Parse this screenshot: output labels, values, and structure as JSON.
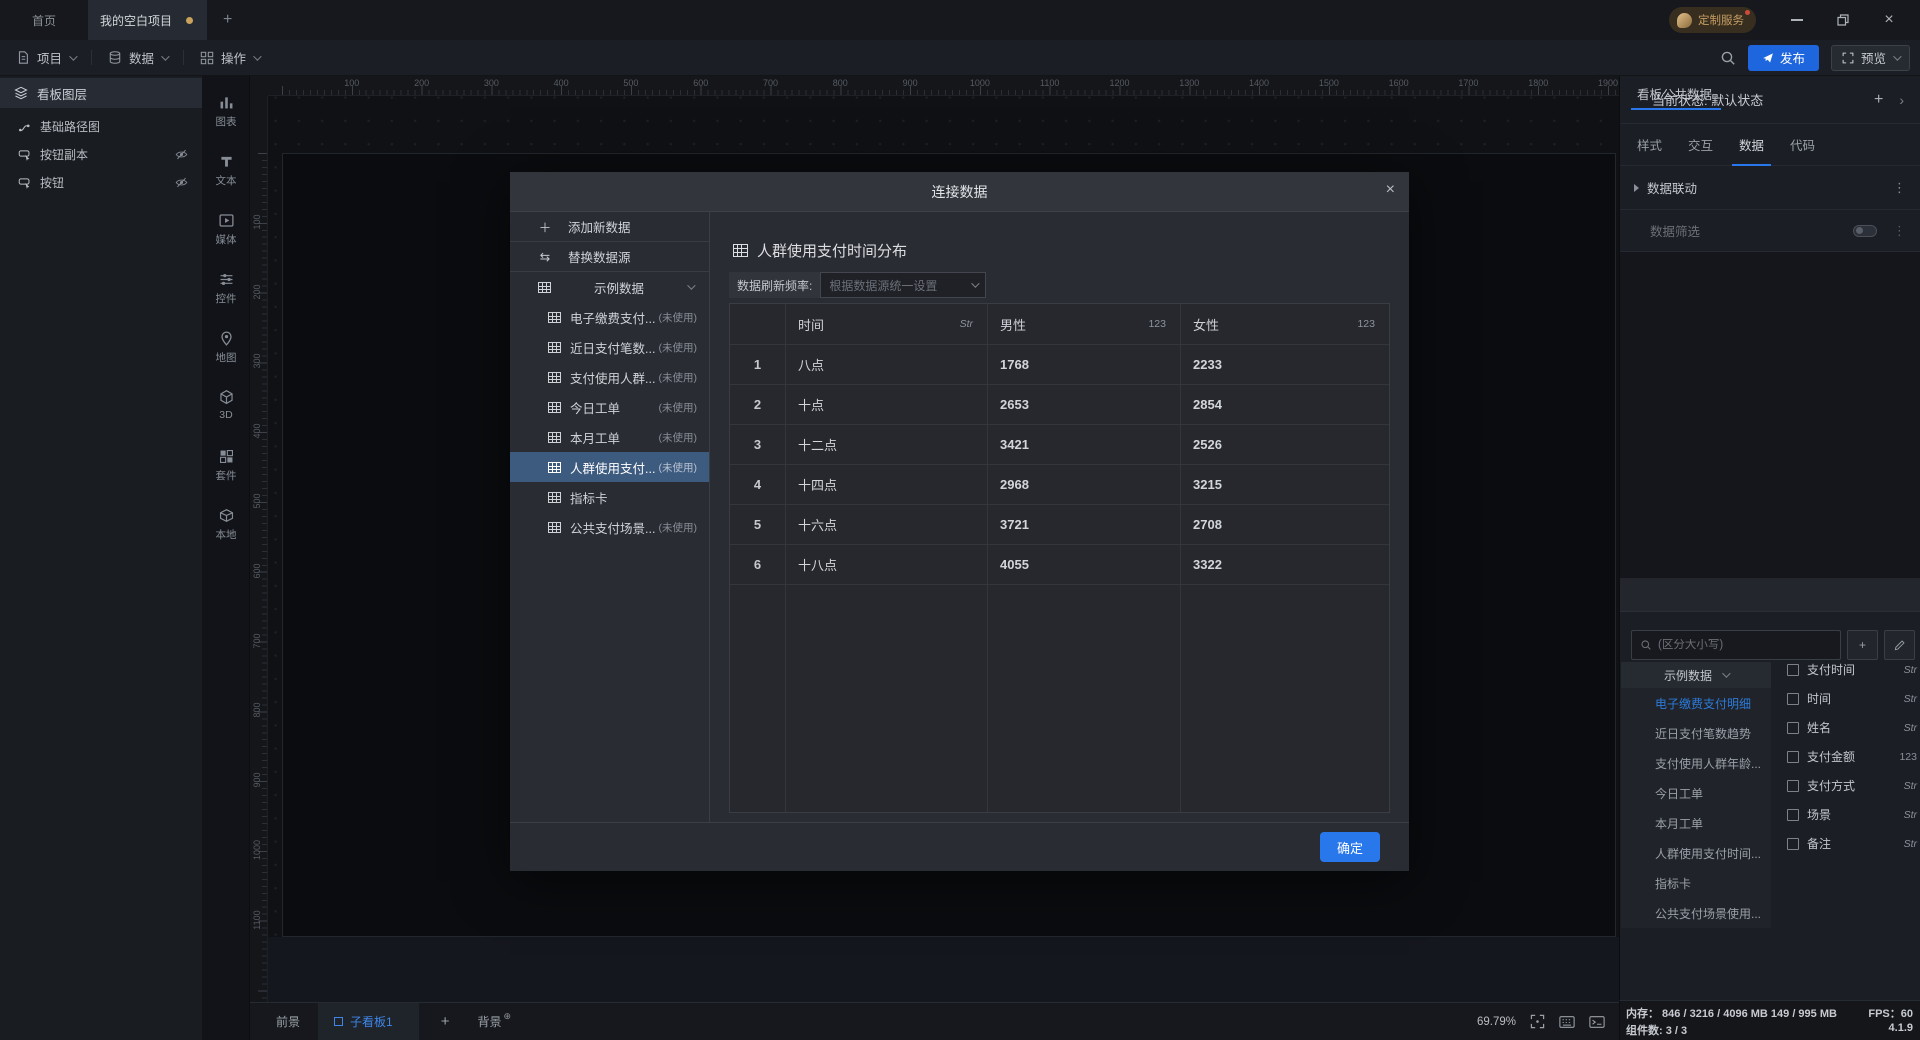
{
  "titlebar": {
    "tabs": [
      {
        "label": "首页"
      },
      {
        "label": "我的空白项目"
      }
    ],
    "new_tab": "+",
    "service": "定制服务"
  },
  "toolbar": {
    "menus": [
      "项目",
      "数据",
      "操作"
    ],
    "publish": "发布",
    "preview": "预览"
  },
  "layers": {
    "title": "看板图层",
    "items": [
      {
        "label": "基础路径图"
      },
      {
        "label": "按钮副本"
      },
      {
        "label": "按钮"
      }
    ]
  },
  "rail": {
    "items": [
      "图表",
      "文本",
      "媒体",
      "控件",
      "地图",
      "3D",
      "套件",
      "本地"
    ]
  },
  "canvas": {
    "h_ruler": [
      "100",
      "200",
      "300",
      "400",
      "500",
      "600",
      "700",
      "800",
      "900",
      "1000",
      "1100",
      "1200",
      "1300",
      "1400",
      "1500",
      "1600",
      "1700",
      "1800",
      "1900"
    ],
    "v_ruler": [
      "100",
      "200",
      "300",
      "400",
      "500",
      "600",
      "700",
      "800",
      "900",
      "1000",
      "1100"
    ]
  },
  "modal": {
    "title": "连接数据",
    "nav": {
      "add": "添加新数据",
      "replace": "替换数据源",
      "group": "示例数据",
      "items": [
        {
          "label": "电子缴费支付...",
          "tag": "(未使用)"
        },
        {
          "label": "近日支付笔数...",
          "tag": "(未使用)"
        },
        {
          "label": "支付使用人群...",
          "tag": "(未使用)"
        },
        {
          "label": "今日工单",
          "tag": "(未使用)"
        },
        {
          "label": "本月工单",
          "tag": "(未使用)"
        },
        {
          "label": "人群使用支付...",
          "tag": "(未使用)"
        },
        {
          "label": "指标卡",
          "tag": ""
        },
        {
          "label": "公共支付场景...",
          "tag": "(未使用)"
        }
      ]
    },
    "dataset_title": "人群使用支付时间分布",
    "refresh_label": "数据刷新频率:",
    "refresh_value": "根据数据源统一设置",
    "table": {
      "columns": [
        {
          "label": "时间",
          "type": "Str"
        },
        {
          "label": "男性",
          "type": "123"
        },
        {
          "label": "女性",
          "type": "123"
        }
      ],
      "rows": [
        [
          "1",
          "八点",
          "1768",
          "2233"
        ],
        [
          "2",
          "十点",
          "2653",
          "2854"
        ],
        [
          "3",
          "十二点",
          "3421",
          "2526"
        ],
        [
          "4",
          "十四点",
          "2968",
          "3215"
        ],
        [
          "5",
          "十六点",
          "3721",
          "2708"
        ],
        [
          "6",
          "十八点",
          "4055",
          "3322"
        ]
      ]
    },
    "confirm": "确定"
  },
  "inspector": {
    "state": "当前状态: 默认状态",
    "tabs": [
      "样式",
      "交互",
      "数据",
      "代码"
    ],
    "linkage": "数据联动",
    "filter": "数据筛选"
  },
  "public_data": {
    "title": "看板公共数据",
    "search_placeholder": "(区分大小写)",
    "group": "示例数据",
    "datasets": [
      "电子缴费支付明细",
      "近日支付笔数趋势",
      "支付使用人群年龄...",
      "今日工单",
      "本月工单",
      "人群使用支付时间...",
      "指标卡",
      "公共支付场景使用..."
    ],
    "fields": [
      {
        "name": "支付时间",
        "type": "Str"
      },
      {
        "name": "时间",
        "type": "Str"
      },
      {
        "name": "姓名",
        "type": "Str"
      },
      {
        "name": "支付金额",
        "type": "123"
      },
      {
        "name": "支付方式",
        "type": "Str"
      },
      {
        "name": "场景",
        "type": "Str"
      },
      {
        "name": "备注",
        "type": "Str"
      }
    ]
  },
  "bottombar": {
    "foreground": "前景",
    "tab": "子看板1",
    "plus": "+",
    "background": "背景",
    "zoom": "69.79%"
  },
  "statusbar": {
    "memory": "内存： 846 / 3216 / 4096 MB  149 / 995 MB",
    "fps": "FPS：60",
    "components": "组件数: 3 / 3",
    "version": "4.1.9"
  }
}
